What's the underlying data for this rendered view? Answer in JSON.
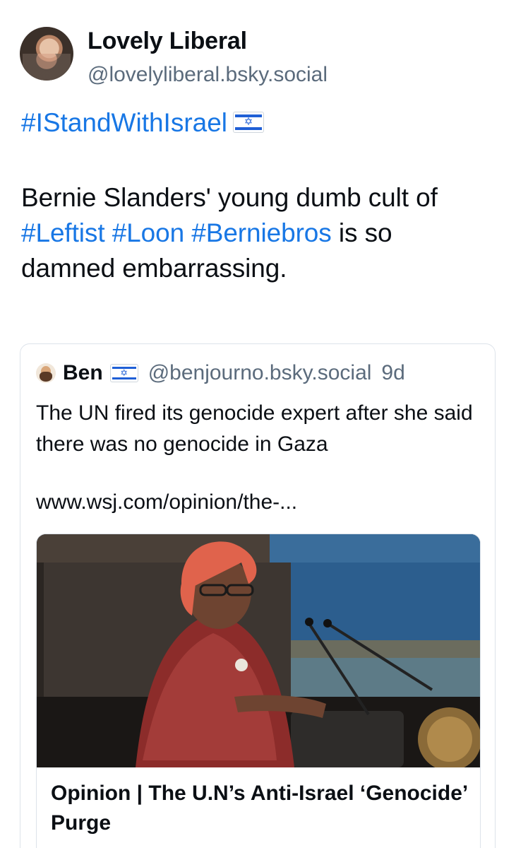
{
  "post": {
    "author": {
      "display_name": "Lovely Liberal",
      "handle": "@lovelyliberal.bsky.social"
    },
    "hashtag_line": "#IStandWithIsrael",
    "flag_emoji_name": "israel-flag",
    "body": {
      "part1": "Bernie Slanders' young dumb cult of ",
      "tag1": "#Leftist",
      "space1": " ",
      "tag2": "#Loon",
      "space2": " ",
      "tag3": "#Berniebros",
      "part2": " is so damned embarrassing."
    }
  },
  "quote": {
    "author_name": "Ben",
    "handle": "@benjourno.bsky.social",
    "time": "9d",
    "text": "The UN fired its genocide expert after she said there was no genocide in Gaza",
    "url": "www.wsj.com/opinion/the-...",
    "card_title": "Opinion | The U.N’s Anti-Israel ‘Genocide’ Purge"
  },
  "colors": {
    "link": "#1877e5",
    "muted": "#5b6b7c",
    "text": "#0b0f14",
    "border": "#dde3ea"
  }
}
